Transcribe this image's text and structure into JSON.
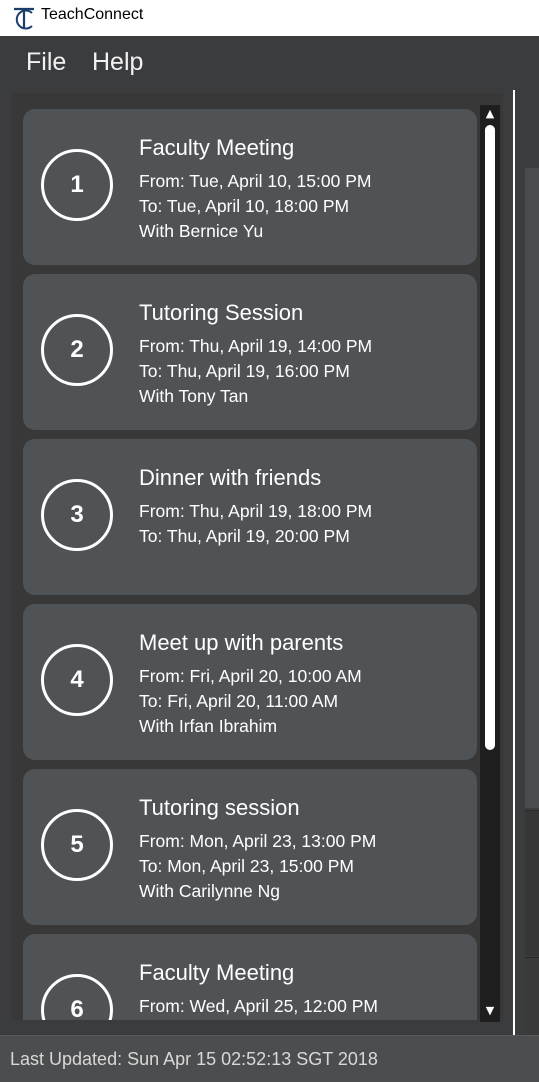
{
  "app": {
    "title": "TeachConnect"
  },
  "menu": {
    "file": "File",
    "help": "Help"
  },
  "appointments": [
    {
      "index": "1",
      "title": "Faculty Meeting",
      "from": "From: Tue, April 10, 15:00 PM",
      "to": "To: Tue, April 10, 18:00 PM",
      "with": "With Bernice Yu"
    },
    {
      "index": "2",
      "title": "Tutoring Session",
      "from": "From: Thu, April 19, 14:00 PM",
      "to": "To: Thu, April 19, 16:00 PM",
      "with": "With Tony Tan"
    },
    {
      "index": "3",
      "title": "Dinner with friends",
      "from": "From: Thu, April 19, 18:00 PM",
      "to": "To: Thu, April 19, 20:00 PM",
      "with": ""
    },
    {
      "index": "4",
      "title": "Meet up with parents",
      "from": "From: Fri, April 20, 10:00 AM",
      "to": "To: Fri, April 20, 11:00 AM",
      "with": "With Irfan Ibrahim"
    },
    {
      "index": "5",
      "title": "Tutoring session",
      "from": "From: Mon, April 23, 13:00 PM",
      "to": "To: Mon, April 23, 15:00 PM",
      "with": "With Carilynne Ng"
    },
    {
      "index": "6",
      "title": "Faculty Meeting",
      "from": "From: Wed, April 25, 12:00 PM",
      "to": "",
      "with": ""
    }
  ],
  "status": {
    "last_updated": "Last Updated: Sun Apr 15 02:52:13 SGT 2018"
  },
  "icons": {
    "logo": "teachconnect-logo-icon",
    "scroll_up": "arrow-up-icon",
    "scroll_down": "arrow-down-icon"
  },
  "colors": {
    "background": "#3b3c3e",
    "card": "#4f5355",
    "text": "#ffffff"
  }
}
